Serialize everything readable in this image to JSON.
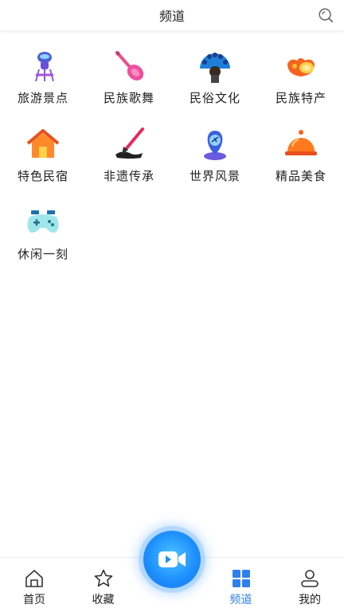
{
  "header": {
    "title": "频道"
  },
  "channels": [
    {
      "label": "旅游景点",
      "icon": "tourist-attraction-icon"
    },
    {
      "label": "民族歌舞",
      "icon": "pipa-instrument-icon"
    },
    {
      "label": "民俗文化",
      "icon": "peacock-costume-icon"
    },
    {
      "label": "民族特产",
      "icon": "specialty-food-icon"
    },
    {
      "label": "特色民宿",
      "icon": "house-icon"
    },
    {
      "label": "非遗传承",
      "icon": "ink-brush-icon"
    },
    {
      "label": "世界风景",
      "icon": "map-pin-plane-icon"
    },
    {
      "label": "精品美食",
      "icon": "food-cloche-icon"
    },
    {
      "label": "休闲一刻",
      "icon": "game-controller-icon"
    }
  ],
  "tabbar": {
    "home": "首页",
    "favorites": "收藏",
    "channels": "频道",
    "mine": "我的"
  },
  "colors": {
    "accent": "#2f7fec"
  }
}
